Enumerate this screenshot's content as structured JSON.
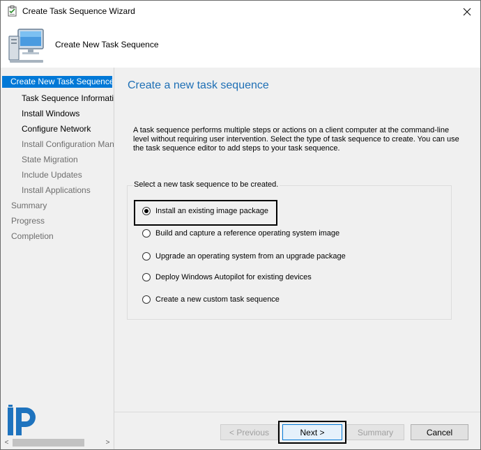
{
  "window": {
    "title": "Create Task Sequence Wizard",
    "close_glyph": "✕"
  },
  "header": {
    "text": "Create New Task Sequence"
  },
  "nav": {
    "items": [
      {
        "label": "Create New Task Sequence",
        "state": "selected"
      },
      {
        "label": "Task Sequence Information",
        "state": "active"
      },
      {
        "label": "Install Windows",
        "state": "active"
      },
      {
        "label": "Configure Network",
        "state": "active"
      },
      {
        "label": "Install Configuration Manager",
        "state": "disabled"
      },
      {
        "label": "State Migration",
        "state": "disabled"
      },
      {
        "label": "Include Updates",
        "state": "disabled"
      },
      {
        "label": "Install Applications",
        "state": "disabled"
      },
      {
        "label": "Summary",
        "state": "disabled"
      },
      {
        "label": "Progress",
        "state": "disabled"
      },
      {
        "label": "Completion",
        "state": "disabled"
      }
    ],
    "scroll_left": "<",
    "scroll_right": ">"
  },
  "main": {
    "title": "Create a new task sequence",
    "description": "A task sequence performs multiple steps or actions on a client computer at the command-line level without requiring user intervention. Select the type of task sequence to create. You can use the task sequence editor to add steps to your task sequence.",
    "group_label": "Select a new task sequence to be created.",
    "options": [
      {
        "label": "Install an existing image package",
        "selected": true
      },
      {
        "label": "Build and capture a reference operating system image",
        "selected": false
      },
      {
        "label": "Upgrade an operating system from an upgrade package",
        "selected": false
      },
      {
        "label": "Deploy Windows Autopilot for existing devices",
        "selected": false
      },
      {
        "label": "Create a new custom task sequence",
        "selected": false
      }
    ]
  },
  "buttons": {
    "previous": "< Previous",
    "next": "Next >",
    "summary": "Summary",
    "cancel": "Cancel"
  },
  "colors": {
    "accent": "#0078d7",
    "title_blue": "#1e6fb5",
    "logo_blue": "#1e73be"
  }
}
